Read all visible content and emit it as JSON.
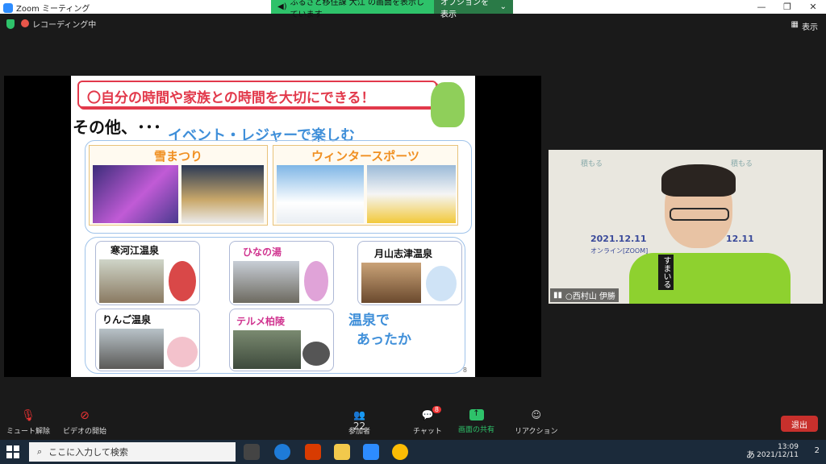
{
  "titlebar": {
    "app_title": "Zoom ミーティング"
  },
  "share_banner": {
    "text": "ふるさと移住課 大江 の画面を表示しています",
    "options_label": "オプションを表示"
  },
  "status": {
    "recording_label": "レコーディング中"
  },
  "view_button": {
    "label": "表示"
  },
  "slide": {
    "headline": "〇自分の時間や家族との時間を大切にできる！",
    "other": "その他、･･･",
    "event_title": "イベント・レジャーで楽しむ",
    "categories": [
      {
        "label": "雪まつり"
      },
      {
        "label": "ウィンタースポーツ"
      }
    ],
    "onsen": [
      {
        "name": "寒河江温泉"
      },
      {
        "name": "ひなの湯"
      },
      {
        "name": "月山志津温泉"
      },
      {
        "name": "りんご温泉"
      },
      {
        "name": "テルメ柏陵"
      }
    ],
    "warm_line1": "温泉で",
    "warm_line2": "あったか",
    "page_num": "8"
  },
  "video": {
    "participant_name": "○西村山 伊勝",
    "backdrop_date1": "2021.12.11",
    "backdrop_date2": "12.11",
    "backdrop_sub": "オンライン[ZOOM]",
    "backdrop_top": "積もる",
    "shirt_text": "すまいる"
  },
  "toolbar": {
    "mute_label": "ミュート解除",
    "video_label": "ビデオの開始",
    "participants_label": "参加者",
    "participants_count": "22",
    "chat_label": "チャット",
    "chat_badge": "8",
    "share_label": "画面の共有",
    "reaction_label": "リアクション",
    "leave_label": "退出"
  },
  "taskbar": {
    "search_placeholder": "ここに入力して検索",
    "time": "13:09",
    "date": "2021/12/11",
    "ime": "あ",
    "notif_count": "2"
  },
  "colors": {
    "share_green": "#2ec26a",
    "headline_red": "#e2394b",
    "accent_blue": "#3f8fd9",
    "leave_red": "#c8302c",
    "orange": "#f09022"
  }
}
